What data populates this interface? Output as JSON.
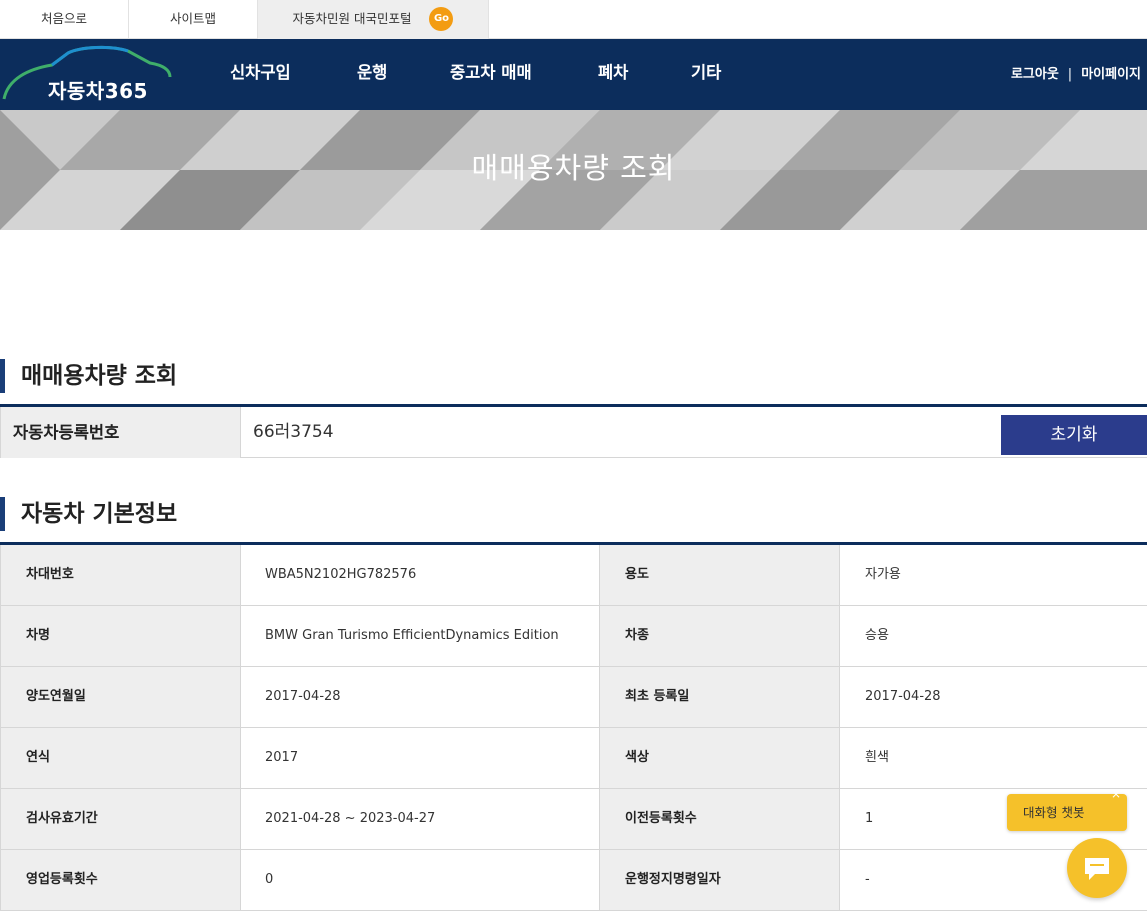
{
  "topbar": {
    "home": "처음으로",
    "sitemap": "사이트맵",
    "portal": "자동차민원 대국민포털",
    "go": "Go"
  },
  "nav": {
    "logo": "자동차365",
    "menu": [
      "신차구입",
      "운행",
      "중고차 매매",
      "폐차",
      "기타"
    ],
    "logout": "로그아웃",
    "separator": "|",
    "mypage": "마이페이지"
  },
  "banner": {
    "title": "매매용차량 조회"
  },
  "search": {
    "section_title": "매매용차량 조회",
    "label": "자동차등록번호",
    "value": "66러3754",
    "reset": "초기화"
  },
  "info": {
    "section_title": "자동차 기본정보",
    "rows": [
      {
        "h1": "차대번호",
        "v1": "WBA5N2102HG782576",
        "h2": "용도",
        "v2": "자가용"
      },
      {
        "h1": "차명",
        "v1": "BMW Gran Turismo EfficientDynamics Edition",
        "h2": "차종",
        "v2": "승용"
      },
      {
        "h1": "양도연월일",
        "v1": "2017-04-28",
        "h2": "최초 등록일",
        "v2": "2017-04-28"
      },
      {
        "h1": "연식",
        "v1": "2017",
        "h2": "색상",
        "v2": "흰색"
      },
      {
        "h1": "검사유효기간",
        "v1": "2021-04-28 ~ 2023-04-27",
        "h2": "이전등록횟수",
        "v2": "1"
      },
      {
        "h1": "영업등록횟수",
        "v1": "0",
        "h2": "운행정지명령일자",
        "v2": "-"
      }
    ]
  },
  "chatbot": {
    "label": "대화형 챗봇",
    "close": "×"
  },
  "colors": {
    "nav": "#0c2d5c",
    "accent": "#2b3c8c",
    "chat": "#f5c12a",
    "go": "#f39c12"
  }
}
